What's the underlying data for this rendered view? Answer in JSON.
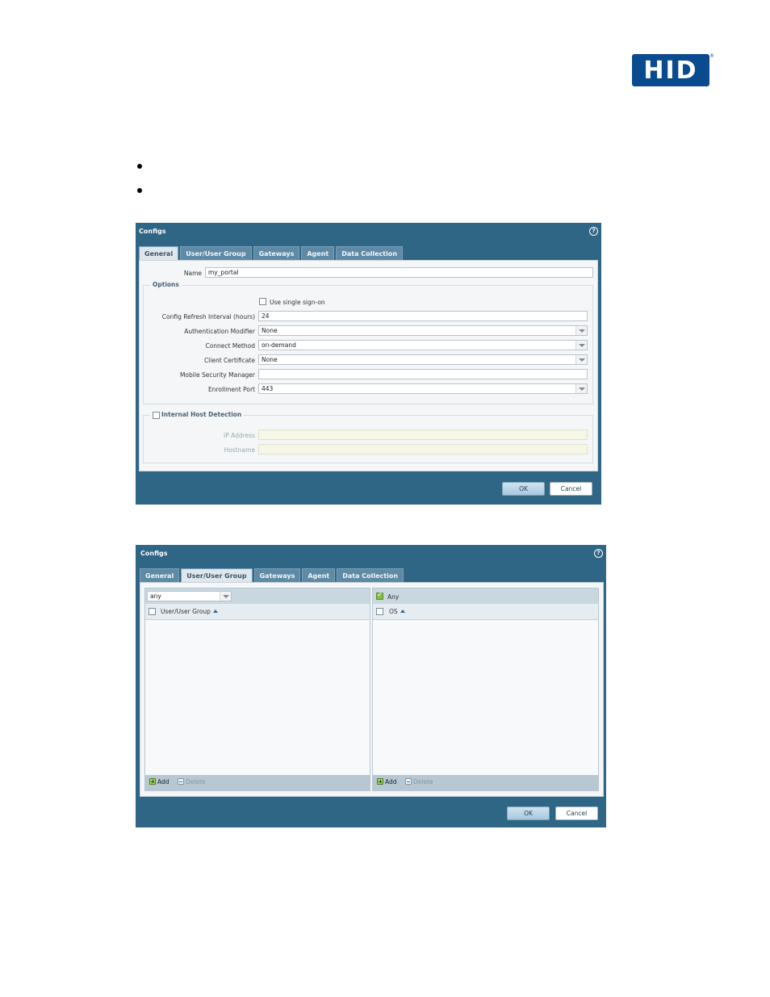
{
  "header": {
    "logo_text": "HID",
    "logo_reg": "®"
  },
  "dialog1": {
    "title": "Configs",
    "tabs": [
      {
        "label": "General",
        "active": true
      },
      {
        "label": "User/User Group",
        "active": false
      },
      {
        "label": "Gateways",
        "active": false
      },
      {
        "label": "Agent",
        "active": false
      },
      {
        "label": "Data Collection",
        "active": false
      }
    ],
    "name_label": "Name",
    "name_value": "my_portal",
    "options_legend": "Options",
    "sso_label": "Use single sign-on",
    "fields": [
      {
        "label": "Config Refresh Interval (hours)",
        "value": "24",
        "dropdown": false
      },
      {
        "label": "Authentication Modifier",
        "value": "None",
        "dropdown": true
      },
      {
        "label": "Connect Method",
        "value": "on-demand",
        "dropdown": true
      },
      {
        "label": "Client Certificate",
        "value": "None",
        "dropdown": true
      },
      {
        "label": "Mobile Security Manager",
        "value": "",
        "dropdown": false
      },
      {
        "label": "Enrollment Port",
        "value": "443",
        "dropdown": true
      }
    ],
    "ihd_legend": "Internal Host Detection",
    "ip_label": "IP Address",
    "hostname_label": "Hostname",
    "ok_label": "OK",
    "cancel_label": "Cancel"
  },
  "dialog2": {
    "title": "Configs",
    "tabs": [
      {
        "label": "General",
        "active": false
      },
      {
        "label": "User/User Group",
        "active": true
      },
      {
        "label": "Gateways",
        "active": false
      },
      {
        "label": "Agent",
        "active": false
      },
      {
        "label": "Data Collection",
        "active": false
      }
    ],
    "user_filter": "any",
    "user_column": "User/User Group",
    "any_label": "Any",
    "os_column": "OS",
    "add_label": "Add",
    "delete_label": "Delete",
    "ok_label": "OK",
    "cancel_label": "Cancel"
  },
  "colors": {
    "dialog_bg": "#2f6686",
    "logo_blue": "#0a4a8f",
    "accent_green": "#7fbf3f"
  },
  "icons": [
    "help-icon",
    "dropdown-arrow-icon",
    "checkbox-icon",
    "plus-icon",
    "minus-icon",
    "sort-up-icon"
  ]
}
